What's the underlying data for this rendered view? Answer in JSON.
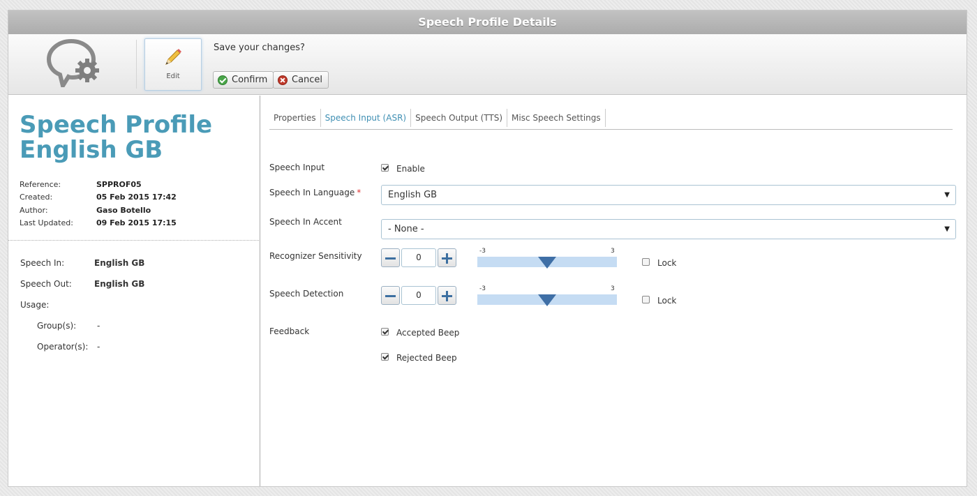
{
  "window": {
    "title": "Speech Profile Details"
  },
  "toolbar": {
    "edit_label": "Edit",
    "save_prompt": "Save your changes?",
    "confirm_label": "Confirm",
    "cancel_label": "Cancel"
  },
  "profile": {
    "title_line1": "Speech Profile",
    "title_line2": "English GB",
    "meta": [
      {
        "key": "Reference:",
        "value": "SPPROF05"
      },
      {
        "key": "Created:",
        "value": "05 Feb 2015 17:42"
      },
      {
        "key": "Author:",
        "value": "Gaso Botello"
      },
      {
        "key": "Last Updated:",
        "value": "09 Feb 2015 17:15"
      }
    ],
    "speech_in_key": "Speech In:",
    "speech_in_value": "English GB",
    "speech_out_key": "Speech Out:",
    "speech_out_value": "English GB",
    "usage_key": "Usage:",
    "groups_key": "Group(s):",
    "groups_value": "-",
    "operators_key": "Operator(s):",
    "operators_value": "-"
  },
  "tabs": [
    {
      "label": "Properties",
      "active": false
    },
    {
      "label": "Speech Input (ASR)",
      "active": true
    },
    {
      "label": "Speech Output (TTS)",
      "active": false
    },
    {
      "label": "Misc Speech Settings",
      "active": false
    }
  ],
  "form": {
    "speech_input_label": "Speech Input",
    "enable_label": "Enable",
    "enable_checked": true,
    "language_label": "Speech In Language",
    "required_marker": "*",
    "language_value": "English GB",
    "accent_label": "Speech In Accent",
    "accent_value": "- None -",
    "sensitivity_label": "Recognizer Sensitivity",
    "sensitivity_value": "0",
    "sensitivity_min": "-3",
    "sensitivity_max": "3",
    "sensitivity_lock_label": "Lock",
    "detection_label": "Speech Detection",
    "detection_value": "0",
    "detection_min": "-3",
    "detection_max": "3",
    "detection_lock_label": "Lock",
    "feedback_label": "Feedback",
    "accepted_beep_label": "Accepted Beep",
    "accepted_beep_checked": true,
    "rejected_beep_label": "Rejected Beep",
    "rejected_beep_checked": true
  },
  "colors": {
    "accent": "#4a9bb7",
    "active_tab": "#3f8fb3",
    "slider_track": "#c5dcf3",
    "slider_thumb": "#3f6fa6"
  },
  "icons": {
    "logo": "speech-bubble-gear-icon",
    "edit": "pencil-icon",
    "confirm": "check-circle-icon",
    "cancel": "x-circle-icon"
  }
}
